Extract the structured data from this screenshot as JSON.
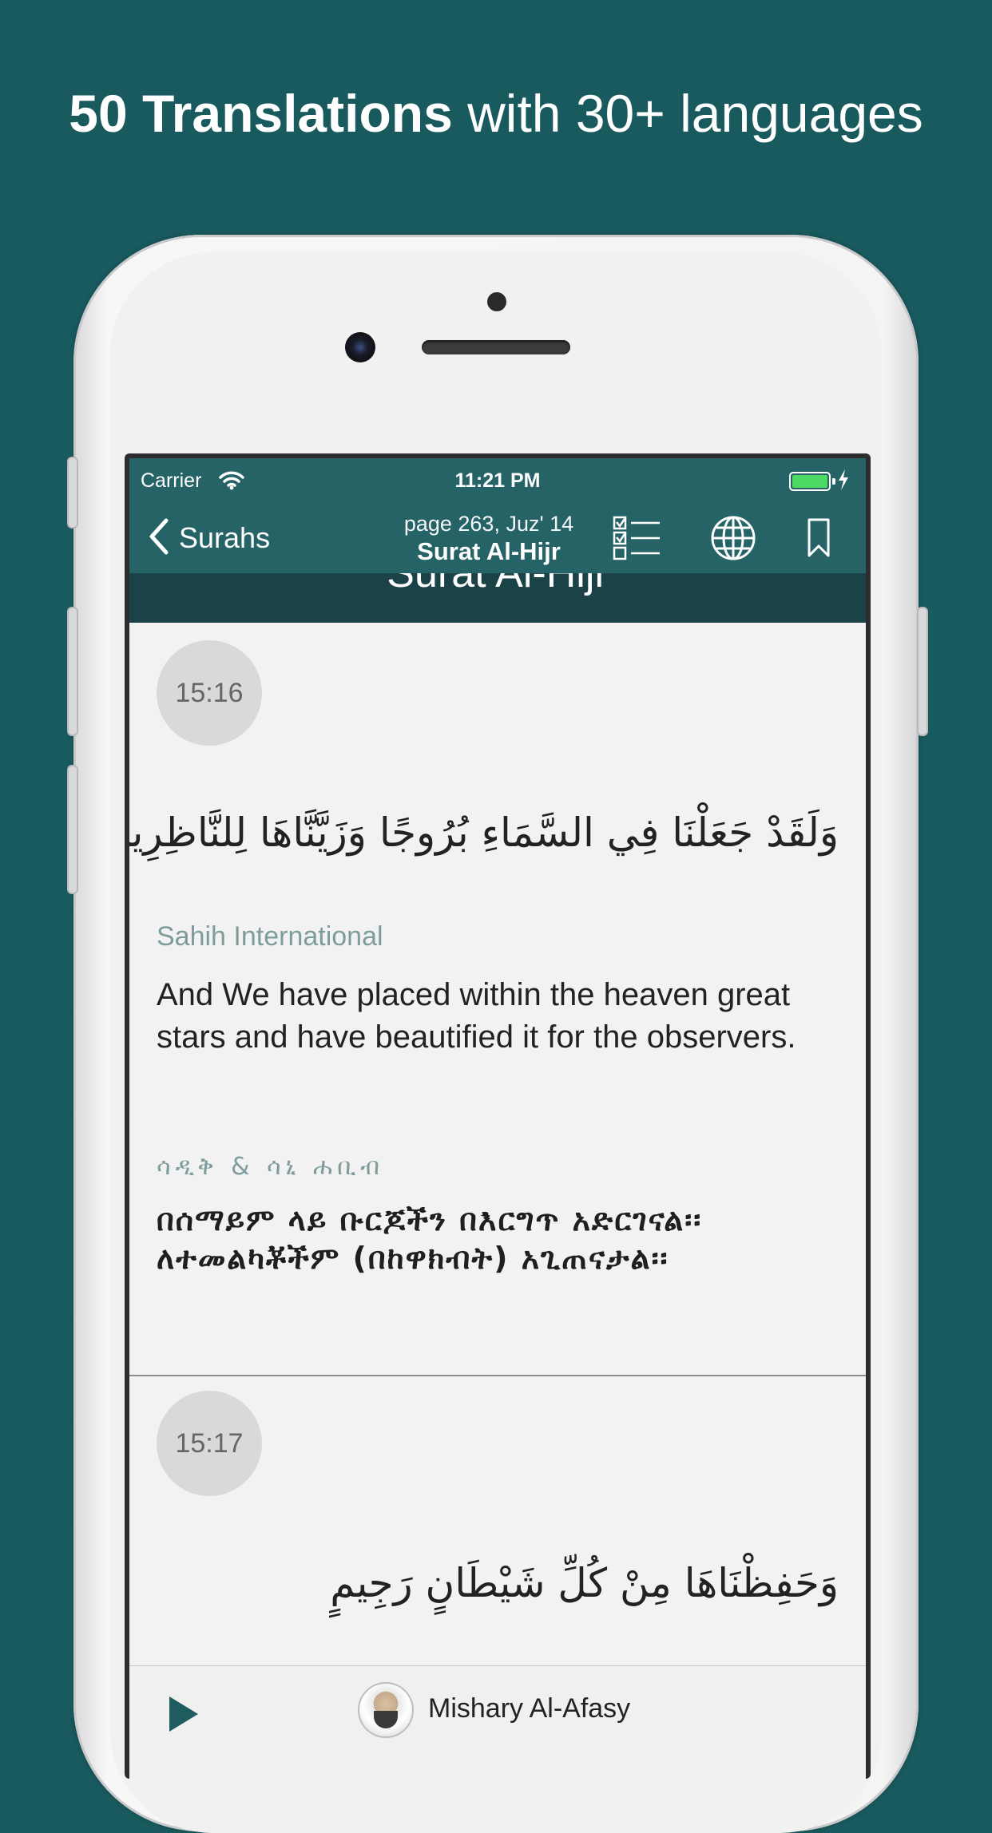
{
  "headline": {
    "bold": "50 Translations",
    "light": "with 30+ languages"
  },
  "colors": {
    "background": "#195a5e",
    "navbar": "#256367",
    "sura_header": "#1b4347",
    "battery": "#4cd964",
    "translation_label": "#7f9c9d"
  },
  "status_bar": {
    "carrier": "Carrier",
    "time": "11:21 PM"
  },
  "nav": {
    "back_label": "Surahs",
    "page_info": "page 263, Juz' 14",
    "title": "Surat Al-Hijr",
    "icons": [
      "chevron-left-icon",
      "checklist-icon",
      "globe-icon",
      "bookmark-icon"
    ]
  },
  "sura_header": {
    "title": "Surat Al-Hijr"
  },
  "verses": [
    {
      "number": "15:16",
      "arabic": "وَلَقَدْ جَعَلْنَا فِي السَّمَاءِ بُرُوجًا وَزَيَّنَّاهَا لِلنَّاظِرِينَ",
      "translation_name": "Sahih International",
      "translation_text": "And We have placed within the heaven great stars and have beautified it for the observers.",
      "amharic_name": "ሳዲቅ & ሳኒ ሐቢብ",
      "amharic_text": "በሰማይም ላይ ቡርጆችን በእርግጥ አድርገናል፡፡ ለተመልካቾችም (በከዋክብት) አጊጠናታል፡፡"
    },
    {
      "number": "15:17",
      "arabic": "وَحَفِظْنَاهَا مِنْ كُلِّ شَيْطَانٍ رَجِيمٍ"
    }
  ],
  "player": {
    "reciter": "Mishary Al-Afasy",
    "icons": [
      "play-icon",
      "reciter-avatar"
    ]
  }
}
